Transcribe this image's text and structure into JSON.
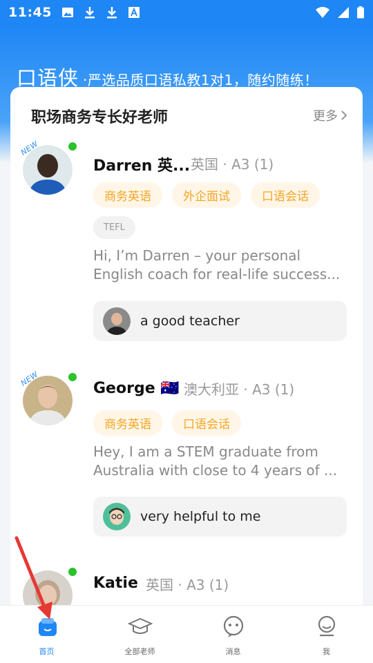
{
  "status_bar": {
    "time": "11:45",
    "left_icons": [
      "image-icon",
      "download-icon",
      "download-icon",
      "font-icon"
    ],
    "right_icons": [
      "wifi-icon",
      "signal-icon",
      "battery-icon"
    ]
  },
  "banner": {
    "title": "口语侠",
    "slogan": "·严选品质口语私教1对1，随约随练！",
    "color": "#1e86f5"
  },
  "card": {
    "title": "职场商务专长好老师",
    "more_label": "更多"
  },
  "teachers": [
    {
      "new_badge": "NEW",
      "name": "Darren 英...",
      "meta": "英国 · A3 (1)",
      "tags": [
        "商务英语",
        "外企面试",
        "口语会话"
      ],
      "extra_tag": "TEFL",
      "bio_line1": "Hi, I’m Darren – your personal",
      "bio_line2": "English coach for real-life success...",
      "review": "a good teacher"
    },
    {
      "new_badge": "NEW",
      "name": "George 🇦🇺",
      "meta": "澳大利亚 · A3 (1)",
      "tags": [
        "商务英语",
        "口语会话"
      ],
      "bio_line1": "Hey, I am a STEM graduate from",
      "bio_line2": "Australia with close to 4 years of ...",
      "review": "very helpful to me"
    },
    {
      "name": "Katie",
      "meta": "英国 · A3 (1)"
    }
  ],
  "bottom_nav": {
    "items": [
      {
        "label": "首页",
        "icon": "home-icon",
        "active": true
      },
      {
        "label": "全部老师",
        "icon": "graduation-cap-icon",
        "active": false
      },
      {
        "label": "消息",
        "icon": "message-icon",
        "active": false
      },
      {
        "label": "我",
        "icon": "profile-icon",
        "active": false
      }
    ]
  },
  "colors": {
    "accent": "#1e86f5",
    "tag_text": "#f5a623",
    "online": "#2bc22b",
    "annotation": "#e53935"
  }
}
